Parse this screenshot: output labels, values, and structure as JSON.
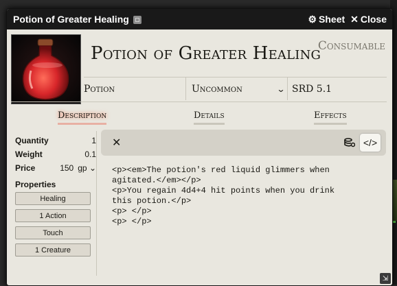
{
  "window": {
    "title": "Potion of Greater Healing",
    "sheet_label": "Sheet",
    "close_label": "Close"
  },
  "header": {
    "name": "Potion of Greater Healing",
    "item_type": "Consumable",
    "summary": {
      "type": "Potion",
      "rarity": "Uncommon",
      "source": "SRD 5.1"
    }
  },
  "tabs": [
    {
      "label": "Description",
      "active": true
    },
    {
      "label": "Details",
      "active": false
    },
    {
      "label": "Effects",
      "active": false
    }
  ],
  "sidebar": {
    "quantity_label": "Quantity",
    "quantity_value": "1",
    "weight_label": "Weight",
    "weight_value": "0.1",
    "price_label": "Price",
    "price_value": "150",
    "price_currency": "gp",
    "properties_title": "Properties",
    "properties": [
      "Healing",
      "1 Action",
      "Touch",
      "1 Creature"
    ]
  },
  "editor": {
    "lines": [
      "<p><em>The potion's red liquid glimmers when",
      "agitated.</em></p>",
      "<p>You regain 4d4+4 hit points when you drink",
      "this potion.</p>",
      "<p> </p>",
      "<p> </p>"
    ]
  },
  "icons": {
    "sheet": "gear-icon",
    "close": "close-icon",
    "editor_close": "close-icon",
    "editor_secrets": "database-lock-icon",
    "editor_source": "code-icon"
  }
}
